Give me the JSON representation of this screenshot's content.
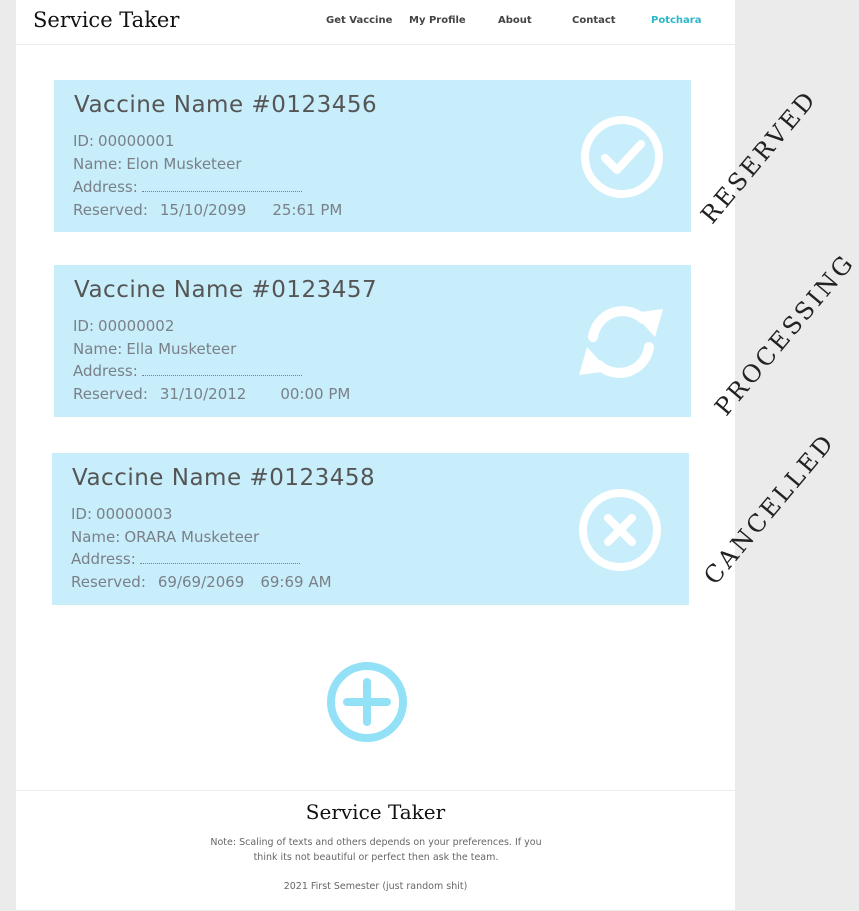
{
  "nav": {
    "brand": "Service Taker",
    "links": [
      "Get Vaccine",
      "My Profile",
      "About",
      "Contact",
      "Potchara"
    ],
    "active_color": "#2cb7c9"
  },
  "cards": [
    {
      "title": "Vaccine Name #0123456",
      "id_label": "ID:",
      "id_value": "00000001",
      "name_label": "Name:",
      "name_value": "Elon Musketeer",
      "address_label": "Address:",
      "reserved_label": "Reserved:",
      "date": "15/10/2099",
      "time": "25:61 PM",
      "status": "RESERVED",
      "icon": "check-circle-icon"
    },
    {
      "title": "Vaccine Name #0123457",
      "id_label": "ID:",
      "id_value": "00000002",
      "name_label": "Name:",
      "name_value": "Ella Musketeer",
      "address_label": "Address:",
      "reserved_label": "Reserved:",
      "date": "31/10/2012",
      "time": "00:00 PM",
      "status": "PROCESSING",
      "icon": "refresh-icon"
    },
    {
      "title": "Vaccine Name #0123458",
      "id_label": "ID:",
      "id_value": "00000003",
      "name_label": "Name:",
      "name_value": "ORARA Musketeer",
      "address_label": "Address:",
      "reserved_label": "Reserved:",
      "date": "69/69/2069",
      "time": "69:69 AM",
      "status": "CANCELLED",
      "icon": "cancel-circle-icon"
    }
  ],
  "colors": {
    "card_bg": "#c8eefb",
    "add_button": "#93e1f7"
  },
  "footer": {
    "title": "Service Taker",
    "note": "Note: Scaling of texts and others depends on your preferences. If you think its not beautiful or perfect then ask the team.",
    "semester": "2021 First Semester (just random shit)"
  }
}
